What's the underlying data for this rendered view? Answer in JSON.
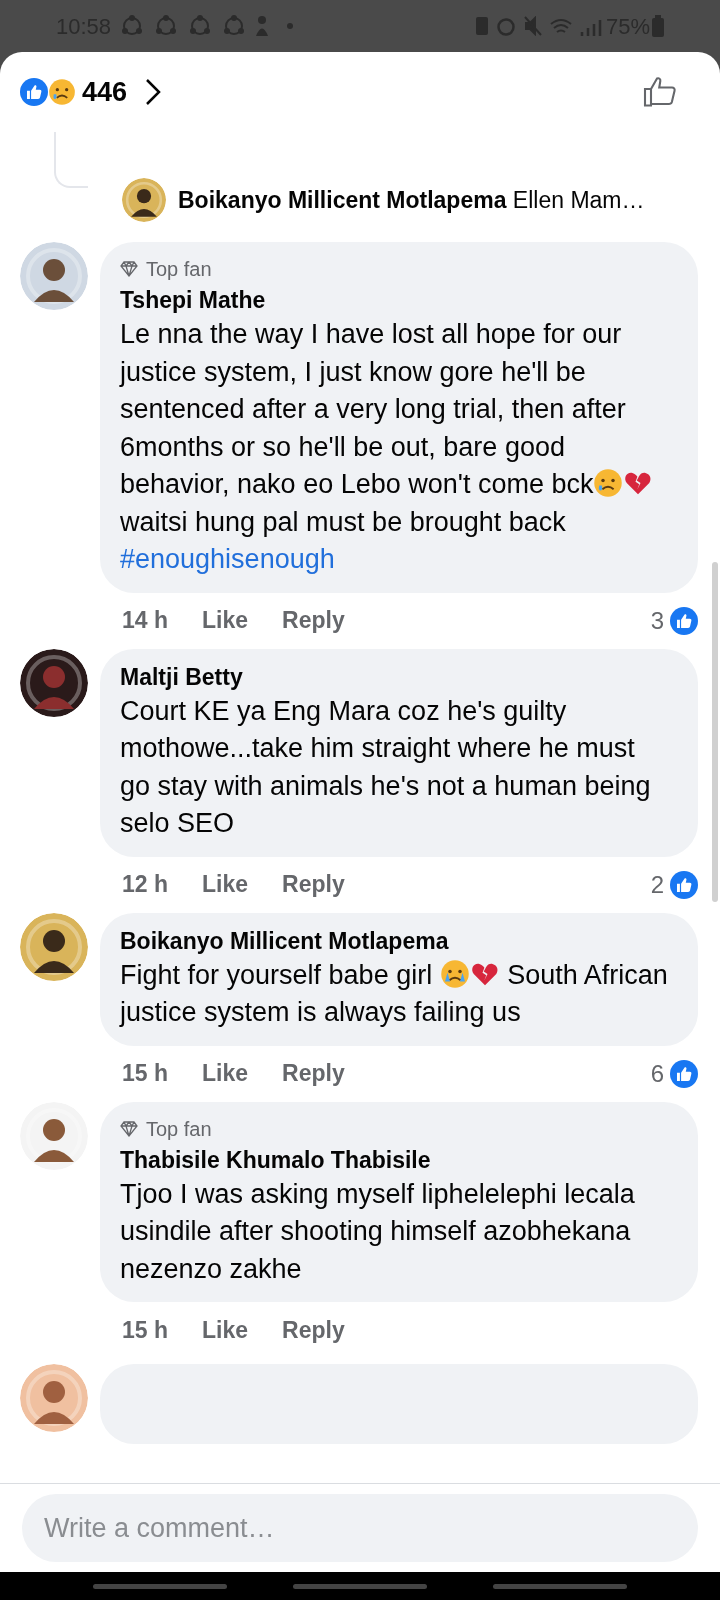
{
  "status_bar": {
    "time": "10:58",
    "battery": "75%"
  },
  "header": {
    "reaction_count": "446"
  },
  "reply_preview": {
    "author": "Boikanyo Millicent Motlapema",
    "text": "Ellen Mam…"
  },
  "comments": [
    {
      "top_fan": true,
      "badge": "Top fan",
      "author": "Tshepi Mathe",
      "body": [
        {
          "kind": "text",
          "text": "Le nna the way I have lost all hope for our justice system, I just know gore he'll be sentenced after a very long trial, then after 6months or so he'll be out, bare good behavior, nako eo Lebo won't come bck"
        },
        {
          "kind": "sad"
        },
        {
          "kind": "broken_heart"
        },
        {
          "kind": "text",
          "text": " waitsi hung pal must be brought back"
        }
      ],
      "hashtag": "#enoughisenough",
      "time": "14 h",
      "like": "Like",
      "reply": "Reply",
      "likes": "3"
    },
    {
      "top_fan": false,
      "author": "Maltji Betty",
      "body": [
        {
          "kind": "text",
          "text": "Court KE ya Eng Mara coz he's guilty mothowe...take him straight where he must go stay with animals he's not a human being selo SEO"
        }
      ],
      "time": "12 h",
      "like": "Like",
      "reply": "Reply",
      "likes": "2"
    },
    {
      "top_fan": false,
      "author": "Boikanyo Millicent Motlapema",
      "body": [
        {
          "kind": "text",
          "text": "Fight for yourself babe girl "
        },
        {
          "kind": "crying"
        },
        {
          "kind": "broken_heart"
        },
        {
          "kind": "text",
          "text": " South African justice system is always failing us"
        }
      ],
      "time": "15 h",
      "like": "Like",
      "reply": "Reply",
      "likes": "6"
    },
    {
      "top_fan": true,
      "badge": "Top fan",
      "author": "Thabisile Khumalo Thabisile",
      "body": [
        {
          "kind": "text",
          "text": "Tjoo I was asking myself liphelelephi lecala usindile after shooting himself azobhekana nezenzo zakhe"
        }
      ],
      "time": "15 h",
      "like": "Like",
      "reply": "Reply"
    }
  ],
  "composer": {
    "placeholder": "Write a comment…"
  }
}
